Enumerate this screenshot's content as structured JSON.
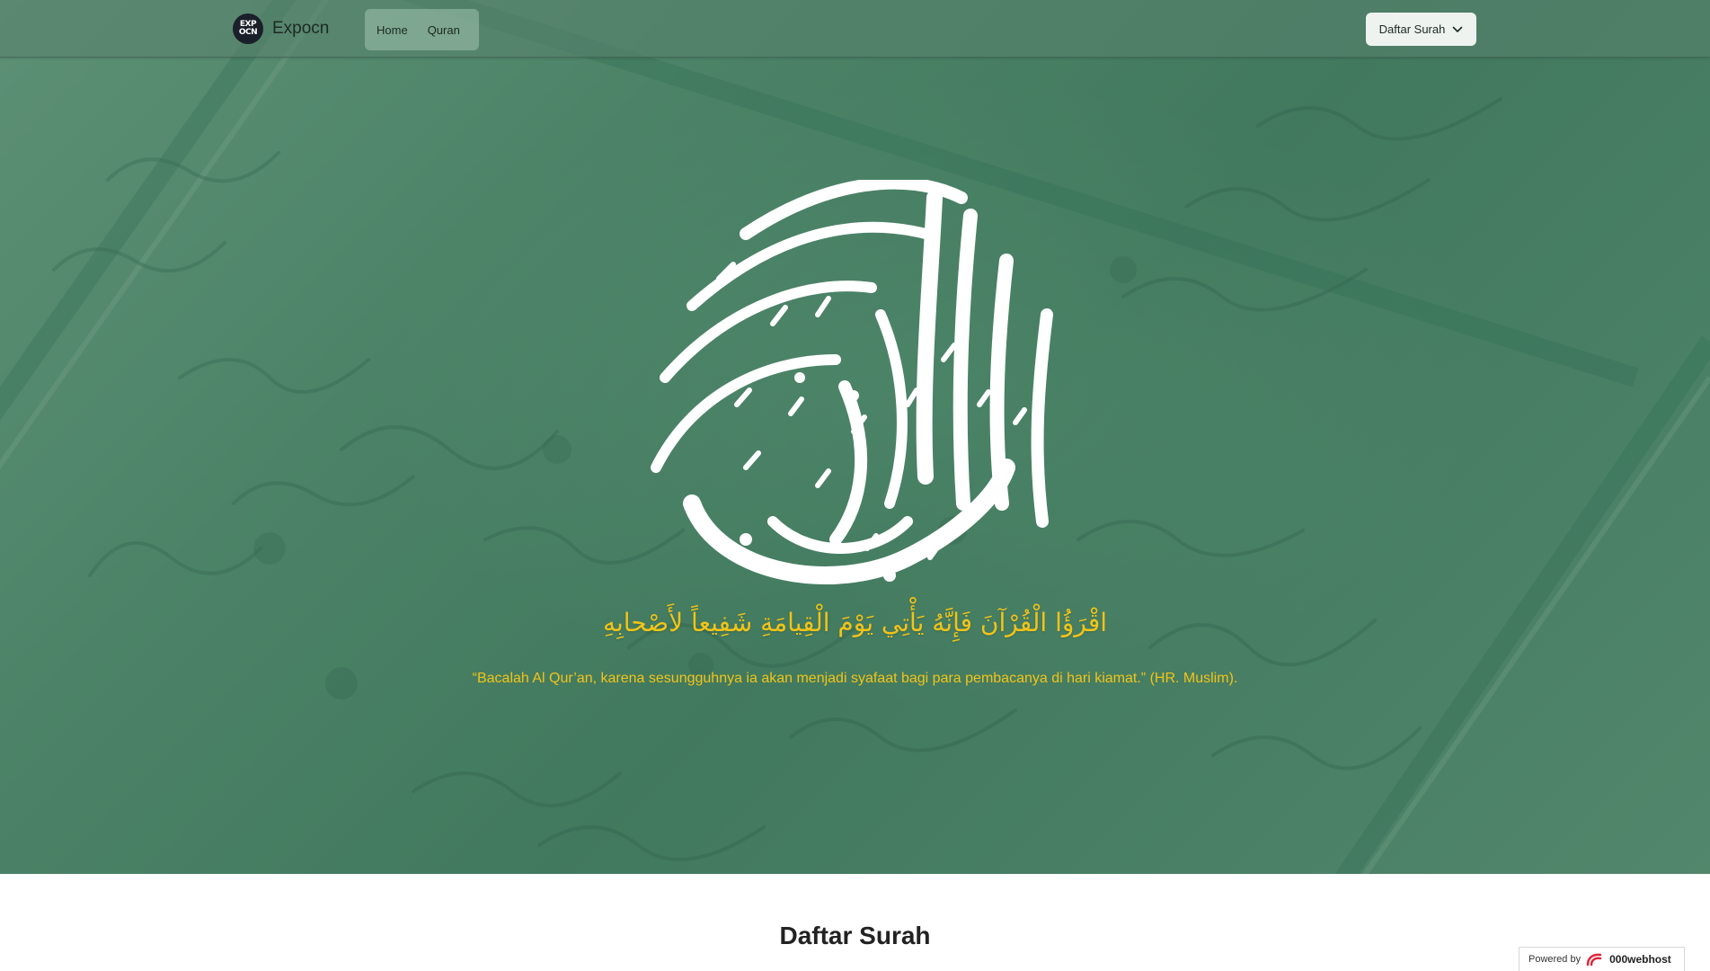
{
  "navbar": {
    "brand_logo_text": "EXP OCN",
    "brand_name": "Expocn",
    "links": [
      {
        "label": "Home"
      },
      {
        "label": "Quran"
      }
    ],
    "dropdown_label": "Daftar Surah"
  },
  "hero": {
    "calligraphy_text": "القرآن الكريم",
    "arabic_verse": "اقْرَؤُا الْقُرْآنَ فَإِنَّهُ يَأْتِي يَوْمَ الْقِيامَةِ شَفِيعاً لأَصْحابِهِ",
    "translation": "“Bacalah Al Qur’an, karena sesungguhnya ia akan menjadi syafaat bagi para pembacanya di hari kiamat.” (HR. Muslim).",
    "colors": {
      "overlay": "#2f7a56",
      "verse_text": "#f2c417"
    }
  },
  "main": {
    "section_title": "Daftar Surah"
  },
  "footer_badge": {
    "prefix": "Powered by",
    "host": "000webhost"
  }
}
